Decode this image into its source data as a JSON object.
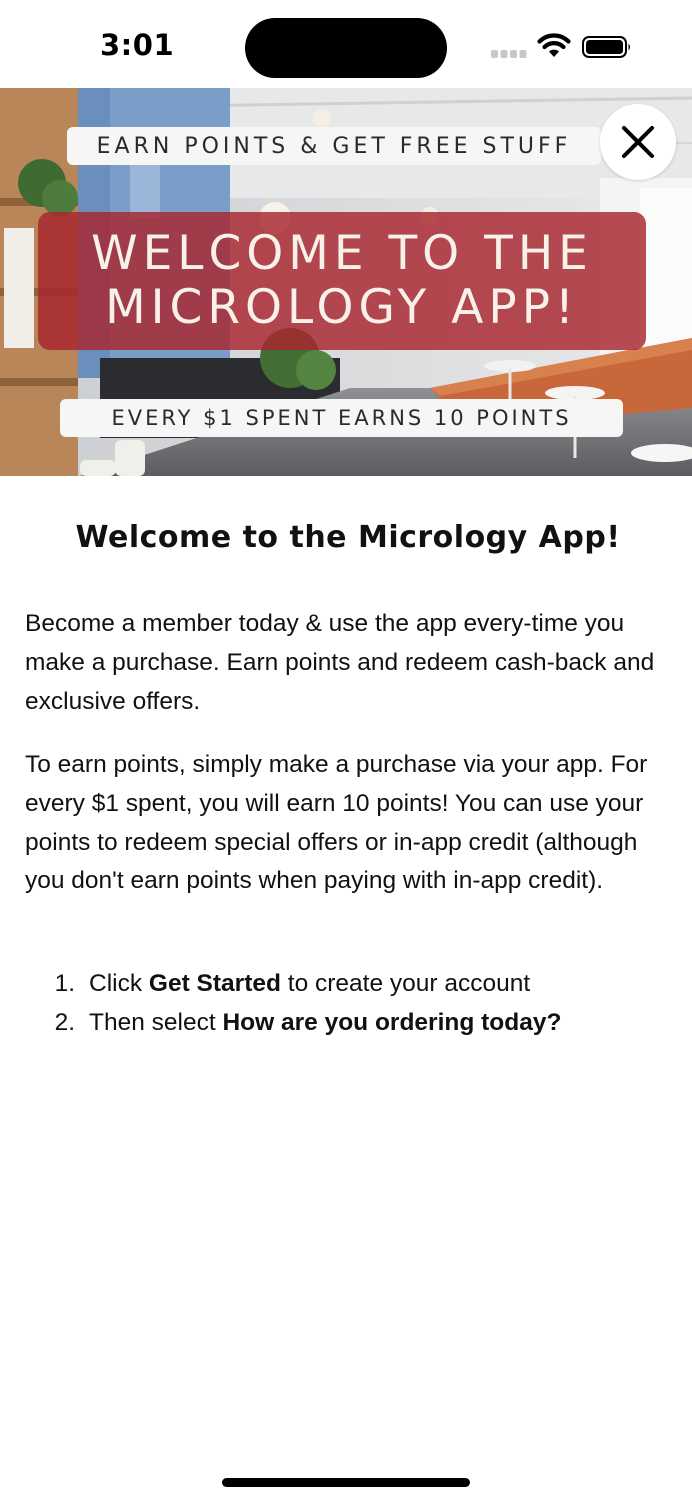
{
  "status_bar": {
    "time": "3:01"
  },
  "hero": {
    "top_pill": "EARN POINTS & GET FREE STUFF",
    "welcome_line_1": "WELCOME TO THE",
    "welcome_line_2": "MICROLOGY APP!",
    "bottom_pill": "EVERY $1 SPENT EARNS 10 POINTS",
    "banner_color": "#a8242e",
    "close_icon": "close-icon"
  },
  "content": {
    "heading": "Welcome to the Micrology App!",
    "paragraph_1": "Become a member today & use the app every-time you make a purchase. Earn points and redeem cash-back and exclusive offers.",
    "paragraph_2": "To earn points, simply make a purchase via your app. For every $1 spent, you will earn 10 points! You can use your points to redeem special offers or in-app credit (although you don't earn points when paying with in-app credit).",
    "steps": [
      {
        "number": "1.",
        "prefix": "Click ",
        "bold": "Get Started",
        "suffix": " to create your account"
      },
      {
        "number": "2.",
        "prefix": "Then select ",
        "bold": "How are you ordering today?",
        "suffix": ""
      }
    ]
  }
}
